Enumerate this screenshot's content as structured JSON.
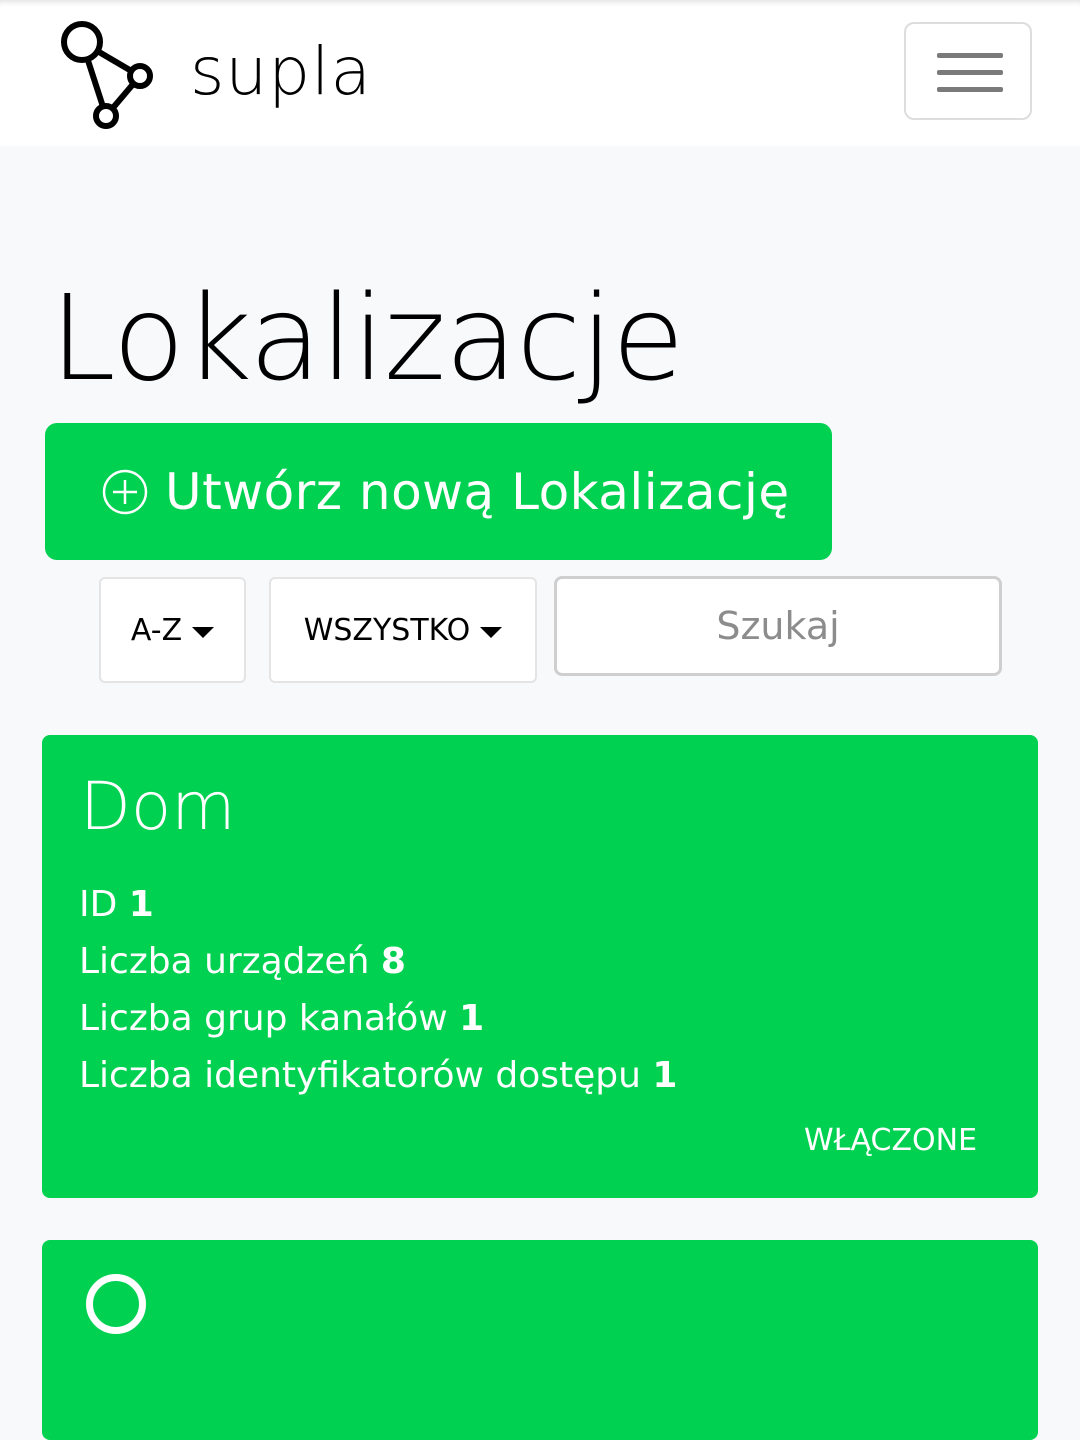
{
  "header": {
    "brand_name": "supla",
    "menu_icon": "hamburger-icon"
  },
  "page": {
    "title": "Lokalizacje"
  },
  "create_button": {
    "icon": "plus-circle-icon",
    "label": "Utwórz nową Lokalizację"
  },
  "filters": {
    "sort_label": "A-Z",
    "status_label": "WSZYSTKO",
    "search_placeholder": "Szukaj"
  },
  "colors": {
    "accent": "#00d151",
    "background": "#f8f9fb"
  },
  "locations": [
    {
      "name": "Dom",
      "stats": [
        {
          "label": "ID",
          "value": "1"
        },
        {
          "label": "Liczba urządzeń",
          "value": "8"
        },
        {
          "label": "Liczba grup kanałów",
          "value": "1"
        },
        {
          "label": "Liczba identyfikatorów dostępu",
          "value": "1"
        }
      ],
      "status": "WŁĄCZONE"
    }
  ]
}
